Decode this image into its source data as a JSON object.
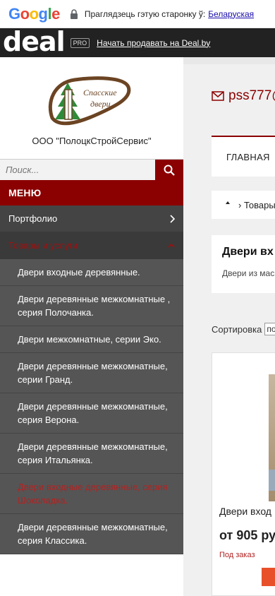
{
  "translate_bar": {
    "logo_letters": [
      "G",
      "o",
      "o",
      "g",
      "l",
      "e"
    ],
    "message": "Праглядзець гэтую старонку ў:",
    "language": "Беларуская"
  },
  "deal_bar": {
    "logo": "deal",
    "pro_badge": "PRO",
    "sell_link": "Начать продавать на Deal.by"
  },
  "sidebar": {
    "logo_text_line1": "Спасские",
    "logo_text_line2": "двери",
    "company_name": "ООО \"ПолоцкСтройСервис\"",
    "search_placeholder": "Поиск...",
    "menu_title": "МЕНЮ",
    "sections": [
      {
        "label": "Портфолио"
      },
      {
        "label": "Товары и услуги"
      }
    ],
    "subitems": [
      {
        "label": "Двери входные деревянные."
      },
      {
        "label": "Двери деревянные межкомнатные , серия Полочанка."
      },
      {
        "label": "Двери межкомнатные, серии Эко."
      },
      {
        "label": "Двери деревянные межкомнатные, серии Гранд."
      },
      {
        "label": "Двери деревянные межкомнатные, серия Верона."
      },
      {
        "label": "Двери деревянные межкомнатные, серия Итальянка."
      },
      {
        "label": "Двери входные деревянные, серия Шоколадка."
      },
      {
        "label": "Двери деревянные межкомнатные, серия Классика."
      }
    ]
  },
  "main": {
    "email": "pss777@",
    "nav_home": "ГЛАВНАЯ",
    "breadcrumb": "Товары",
    "category_title": "Двери вх",
    "category_desc": "Двери из мас",
    "sort_label": "Сортировка",
    "sort_value": "по",
    "product": {
      "name": "Двери вход",
      "price": "от 905 ру",
      "stock": "Под заказ"
    }
  },
  "colors": {
    "brand_red": "#8b0000",
    "menu_dark": "#555555",
    "active_red": "#b22222"
  }
}
